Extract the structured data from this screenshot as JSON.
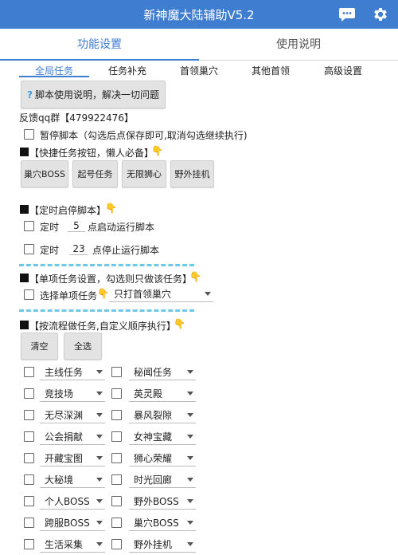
{
  "app": {
    "title": "新神魔大陆辅助V5.2"
  },
  "tabs": [
    "功能设置",
    "使用说明"
  ],
  "subtabs": [
    "全局任务",
    "任务补充",
    "首领巢穴",
    "其他首领",
    "高级设置"
  ],
  "help_button": "脚本使用说明，解决一切问题",
  "help_icon": "?",
  "feedback": "反馈qq群【479922476】",
  "pause": {
    "label": "暂停脚本（勾选后点保存即可,取消勾选继续执行)",
    "checked": false
  },
  "quick": {
    "heading": "【快捷任务按钮，懒人必备】",
    "buttons": [
      "巢穴BOSS",
      "起号任务",
      "无限狮心",
      "野外挂机"
    ]
  },
  "timer": {
    "heading": "【定时启停脚本】",
    "start": {
      "label": "定时",
      "value": "5",
      "suffix": "点启动运行脚本",
      "checked": false
    },
    "stop": {
      "label": "定时",
      "value": "23",
      "suffix": "点停止运行脚本",
      "checked": false
    }
  },
  "single": {
    "heading": "【单项任务设置，勾选则只做该任务】",
    "label": "选择单项任务",
    "selected": "只打首领巢穴",
    "checked": false
  },
  "flow": {
    "heading": "【按流程做任务,自定义顺序执行】",
    "clear": "清空",
    "select_all": "全选",
    "rows": [
      [
        "主线任务",
        "秘闻任务"
      ],
      [
        "竞技场",
        "英灵殿"
      ],
      [
        "无尽深渊",
        "暴风裂隙"
      ],
      [
        "公会捐献",
        "女神宝藏"
      ],
      [
        "开藏宝图",
        "狮心荣耀"
      ],
      [
        "大秘境",
        "时光回廊"
      ],
      [
        "个人BOSS",
        "野外BOSS"
      ],
      [
        "跨服BOSS",
        "巢穴BOSS"
      ],
      [
        "生活采集",
        "野外挂机"
      ]
    ]
  },
  "icons": {
    "chat": "chat-bubble-icon",
    "settings": "gear-icon",
    "hand": "pointing-down-hand-icon"
  },
  "colors": {
    "accent": "#3f7dd1",
    "dash": "#6fc9e6",
    "hand": "#f0b400"
  }
}
